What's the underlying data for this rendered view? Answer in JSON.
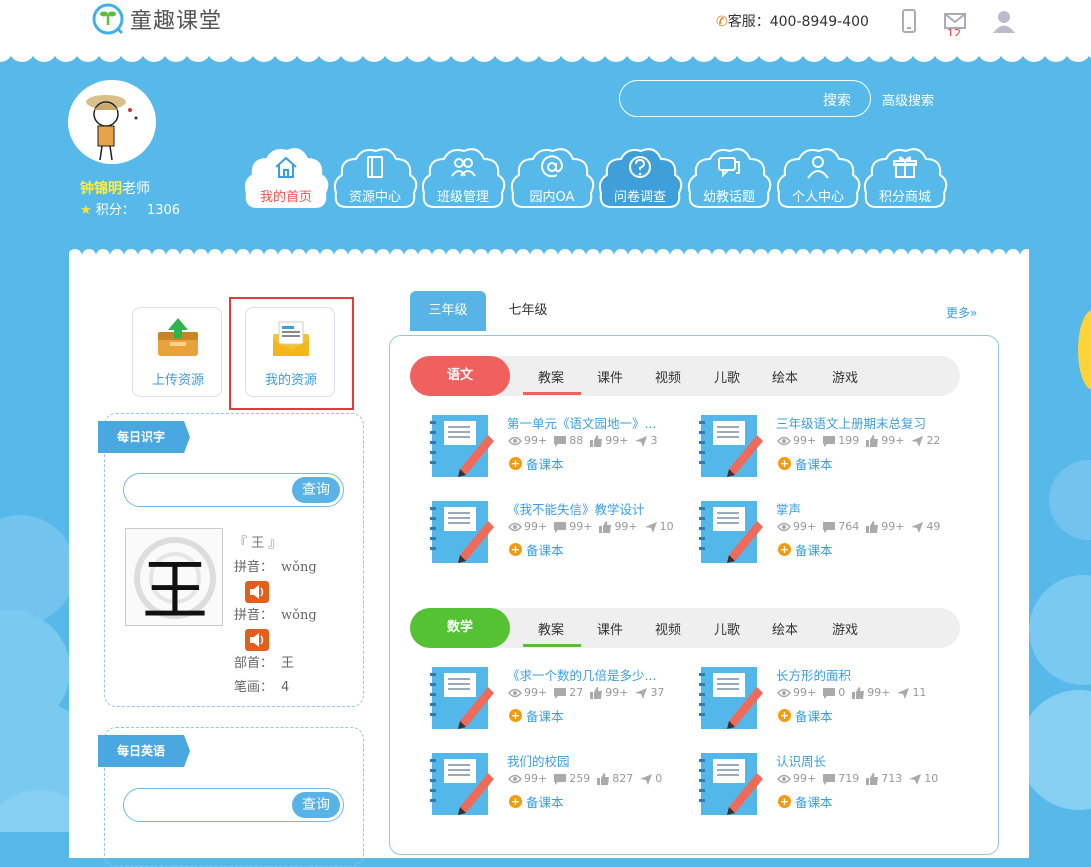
{
  "header": {
    "logo_text": "童趣课堂",
    "phone_label": "客服：",
    "phone_number": "400-8949-400",
    "message_count": "12"
  },
  "user": {
    "name": "钟锦明",
    "role": "老师",
    "points_label": "积分：",
    "points_value": "1306"
  },
  "search": {
    "button": "搜索",
    "advanced": "高级搜索"
  },
  "nav": [
    {
      "label": "我的首页",
      "icon": "home-icon"
    },
    {
      "label": "资源中心",
      "icon": "book-icon"
    },
    {
      "label": "班级管理",
      "icon": "users-icon"
    },
    {
      "label": "园内OA",
      "icon": "at-icon"
    },
    {
      "label": "问卷调查",
      "icon": "question-icon"
    },
    {
      "label": "幼教话题",
      "icon": "chat-icon"
    },
    {
      "label": "个人中心",
      "icon": "person-icon"
    },
    {
      "label": "积分商城",
      "icon": "gift-icon"
    }
  ],
  "resources": {
    "upload": "上传资源",
    "mine": "我的资源"
  },
  "daily_char": {
    "ribbon": "每日识字",
    "query_btn": "查询",
    "char": "王",
    "bracket_char": "『 王 』",
    "pinyin_label": "拼音：",
    "pinyin1": "wǒng",
    "pinyin2": "wǒng",
    "radical_label": "部首：",
    "radical": "王",
    "strokes_label": "笔画：",
    "strokes": "4"
  },
  "daily_english": {
    "ribbon": "每日英语",
    "query_btn": "查询"
  },
  "grades": {
    "active": "三年级",
    "other": "七年级",
    "more": "更多»"
  },
  "subject_tabs": [
    "教案",
    "课件",
    "视频",
    "儿歌",
    "绘本",
    "游戏"
  ],
  "subjects": [
    {
      "name": "语文",
      "color": "#f0605f",
      "items": [
        {
          "title": "第一单元《语文园地一》...",
          "views": "99+",
          "comments": "88",
          "likes": "99+",
          "shares": "3"
        },
        {
          "title": "三年级语文上册期末总复习",
          "views": "99+",
          "comments": "199",
          "likes": "99+",
          "shares": "22"
        },
        {
          "title": "《我不能失信》教学设计",
          "views": "99+",
          "comments": "99+",
          "likes": "99+",
          "shares": "10"
        },
        {
          "title": "掌声",
          "views": "99+",
          "comments": "764",
          "likes": "99+",
          "shares": "49"
        }
      ]
    },
    {
      "name": "数学",
      "color": "#55c234",
      "items": [
        {
          "title": "《求一个数的几倍是多少...",
          "views": "99+",
          "comments": "27",
          "likes": "99+",
          "shares": "37"
        },
        {
          "title": "长方形的面积",
          "views": "99+",
          "comments": "0",
          "likes": "99+",
          "shares": "11"
        },
        {
          "title": "我们的校园",
          "views": "99+",
          "comments": "259",
          "likes": "827",
          "shares": "0"
        },
        {
          "title": "认识周长",
          "views": "99+",
          "comments": "719",
          "likes": "713",
          "shares": "10"
        }
      ]
    }
  ],
  "prep_label": "备课本"
}
